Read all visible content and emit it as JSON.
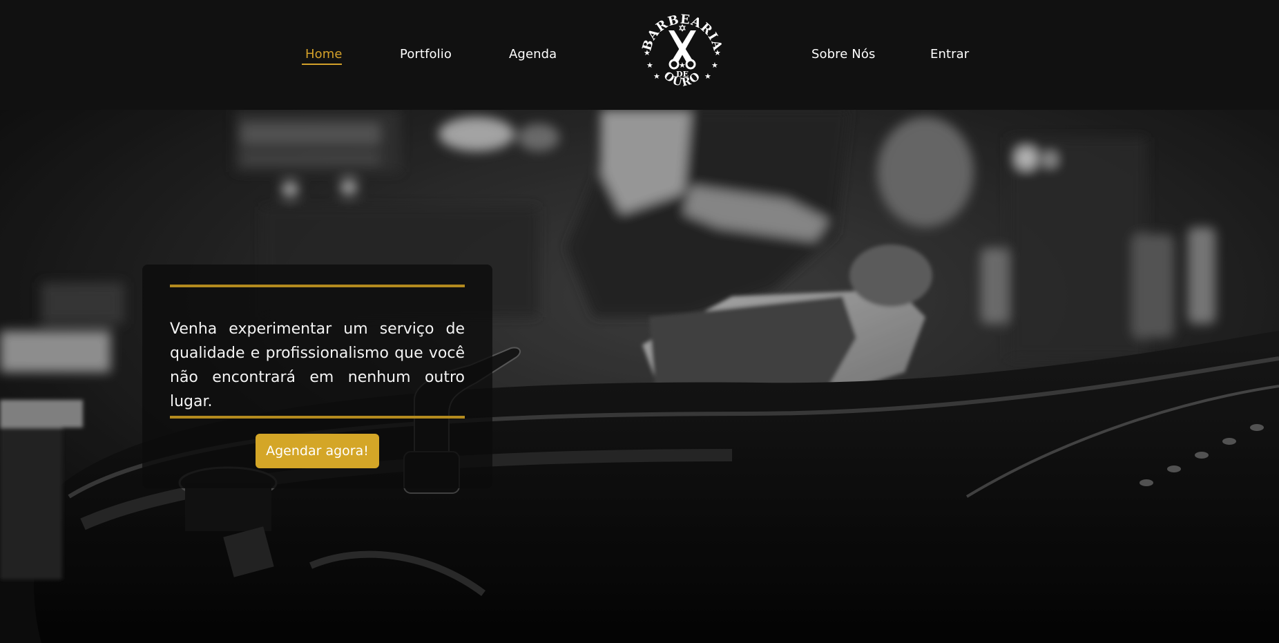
{
  "nav": {
    "home": "Home",
    "portfolio": "Portfolio",
    "agenda": "Agenda",
    "sobre": "Sobre Nós",
    "entrar": "Entrar"
  },
  "logo": {
    "top_text": "BARBEARIA",
    "middle_text": "DE",
    "bottom_text": "OURO"
  },
  "hero": {
    "message": "Venha experimentar um serviço de qualidade e profissionalismo que você não encontrará em nenhum outro lugar.",
    "cta_label": "Agendar agora!"
  },
  "colors": {
    "accent": "#d4a12a",
    "card_line": "#b38a1e",
    "header_bg": "#111111"
  }
}
